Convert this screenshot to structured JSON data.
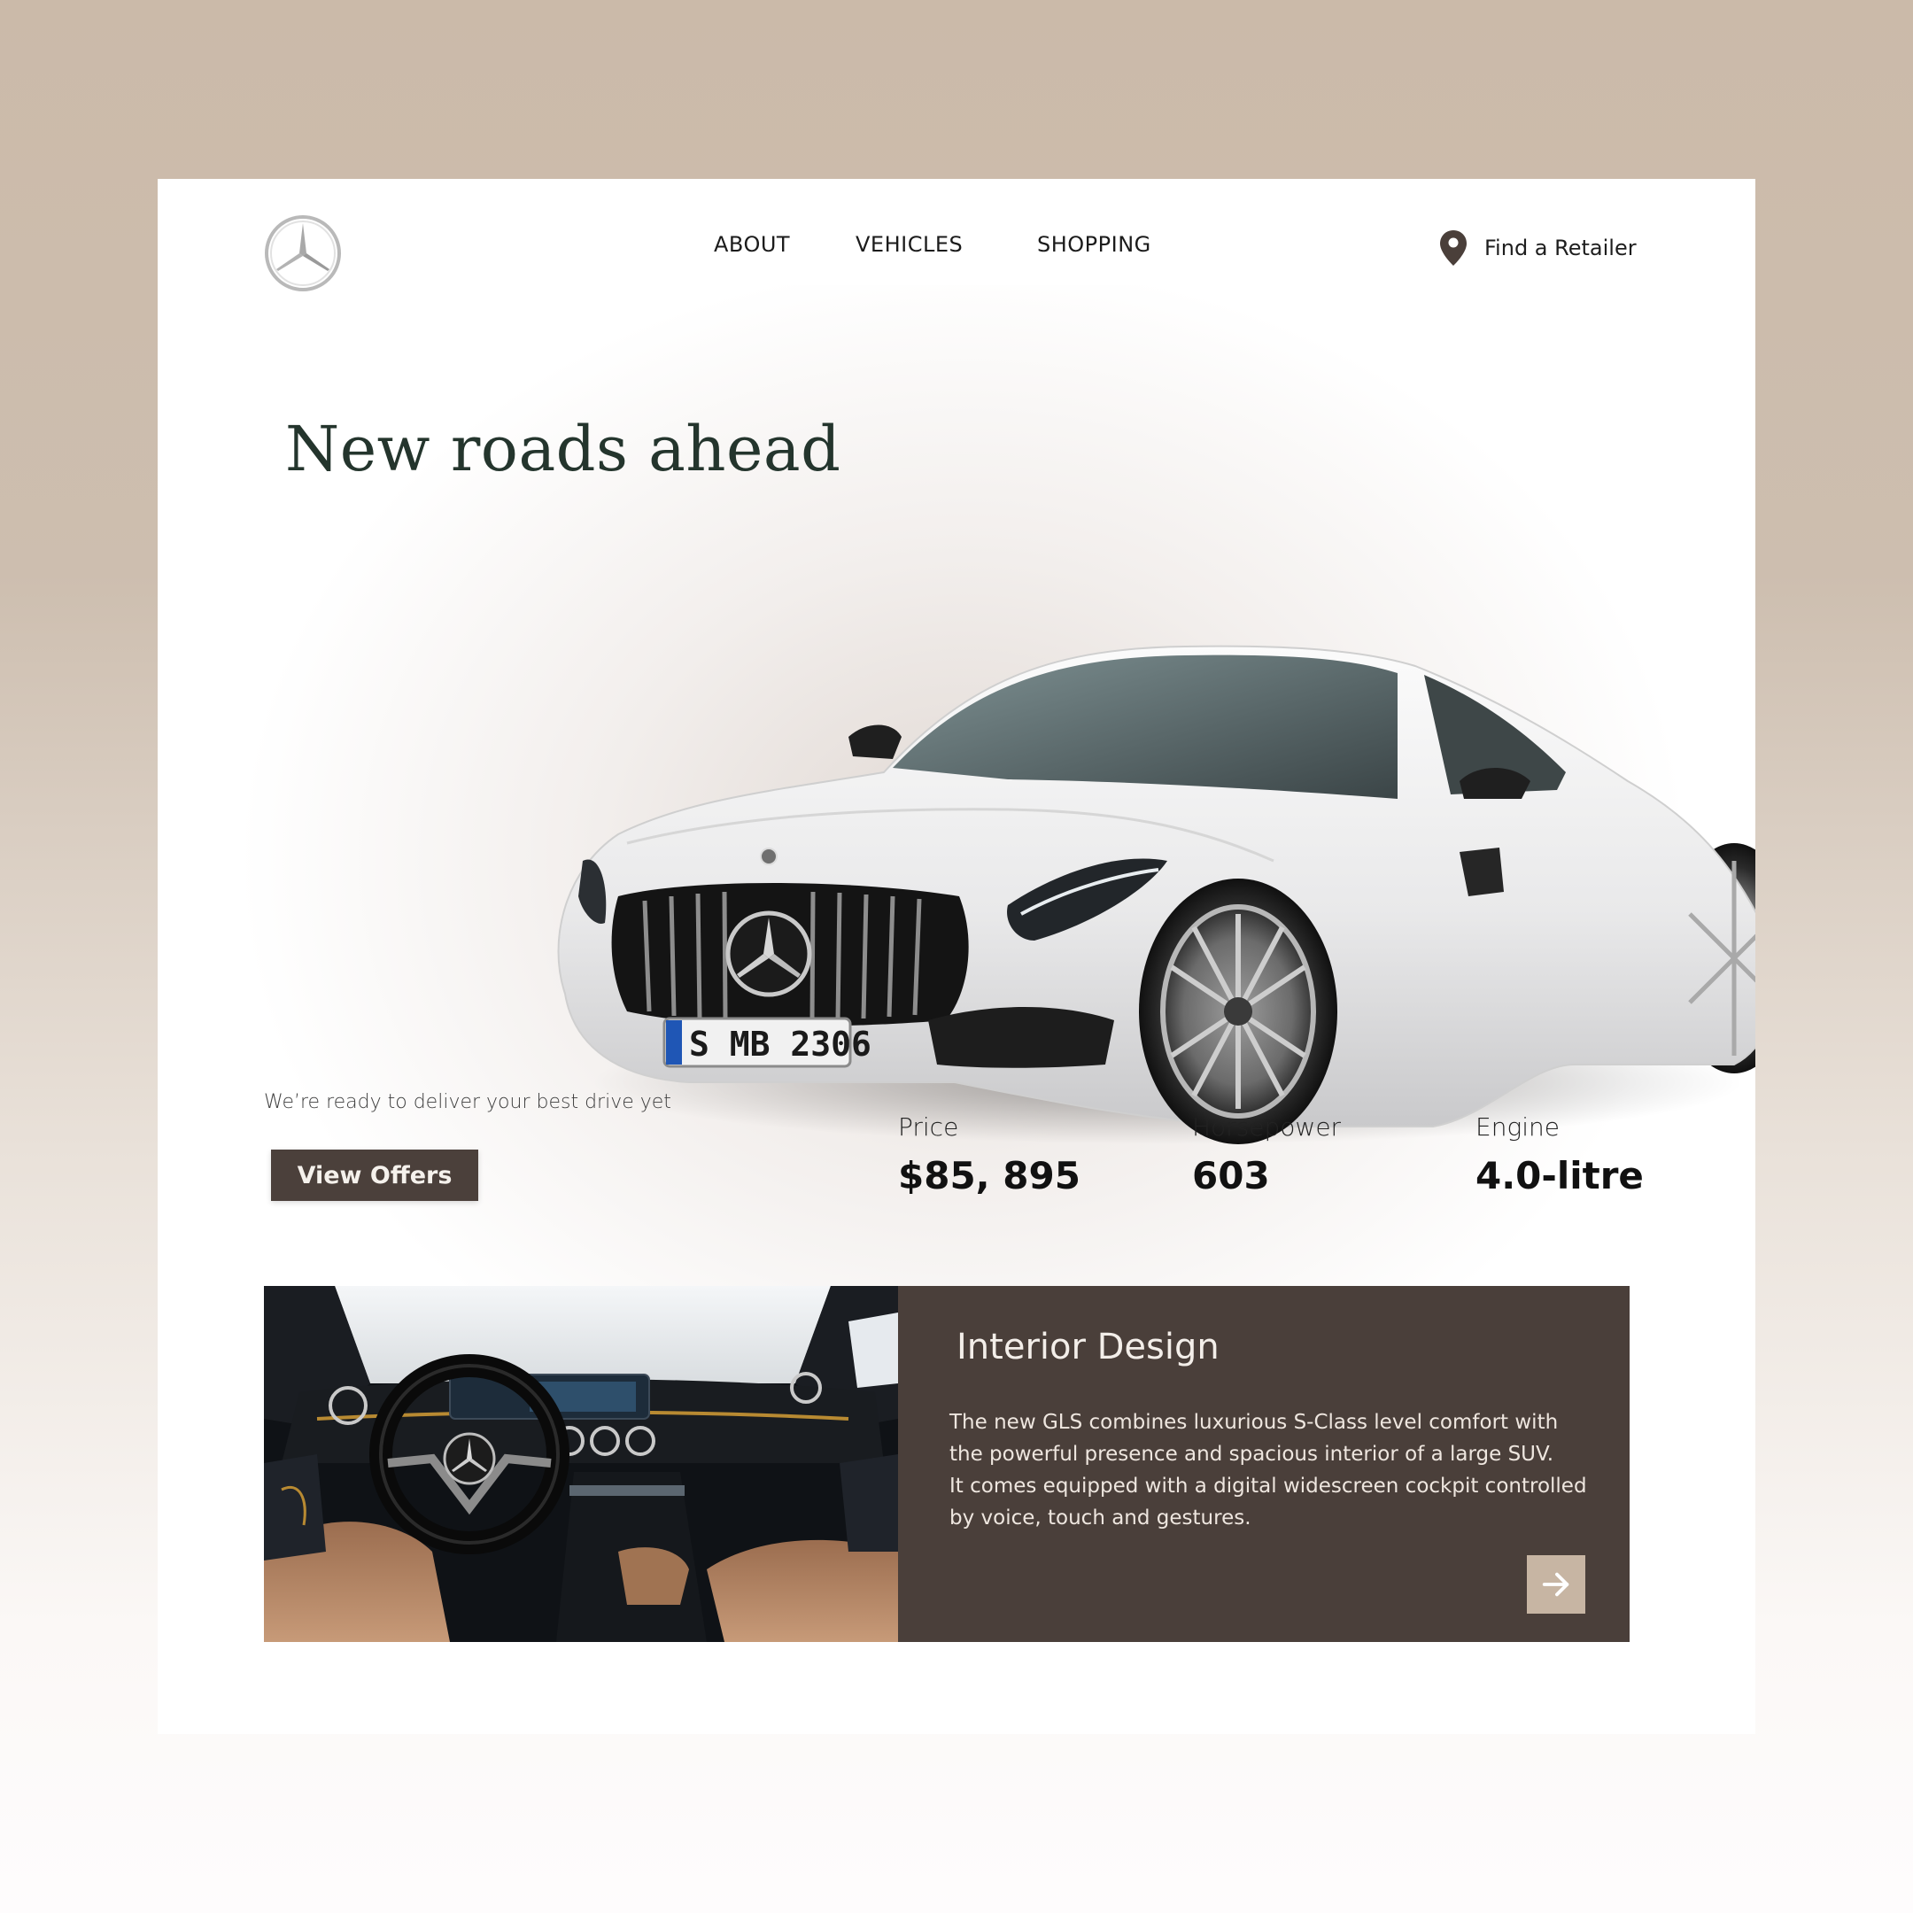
{
  "nav": {
    "items": [
      {
        "label": "ABOUT"
      },
      {
        "label": "VEHICLES"
      },
      {
        "label": "SHOPPING"
      }
    ],
    "retailer_label": "Find a Retailer",
    "retailer_icon": "location-pin-icon",
    "logo_icon": "three-pointed-star-logo"
  },
  "hero": {
    "title": "New roads ahead",
    "tagline": "We’re ready to deliver your best drive yet",
    "cta_label": "View Offers",
    "plate": "S MB 2306"
  },
  "specs": [
    {
      "label": "Price",
      "value": "$85, 895"
    },
    {
      "label": "Horsepower",
      "value": "603"
    },
    {
      "label": "Engine",
      "value": "4.0-litre"
    }
  ],
  "interior": {
    "title": "Interior Design",
    "lines": [
      "The new GLS combines luxurious S-Class level comfort with",
      "the powerful presence and spacious interior of a large SUV.",
      "It comes equipped with a digital widescreen cockpit controlled",
      "by voice, touch and gestures."
    ],
    "next_icon": "arrow-right-icon"
  },
  "colors": {
    "background": "#cbbaa9",
    "brand_dark": "#4a3f3a",
    "accent_light": "#c7b5a3",
    "title_green": "#24352d"
  }
}
